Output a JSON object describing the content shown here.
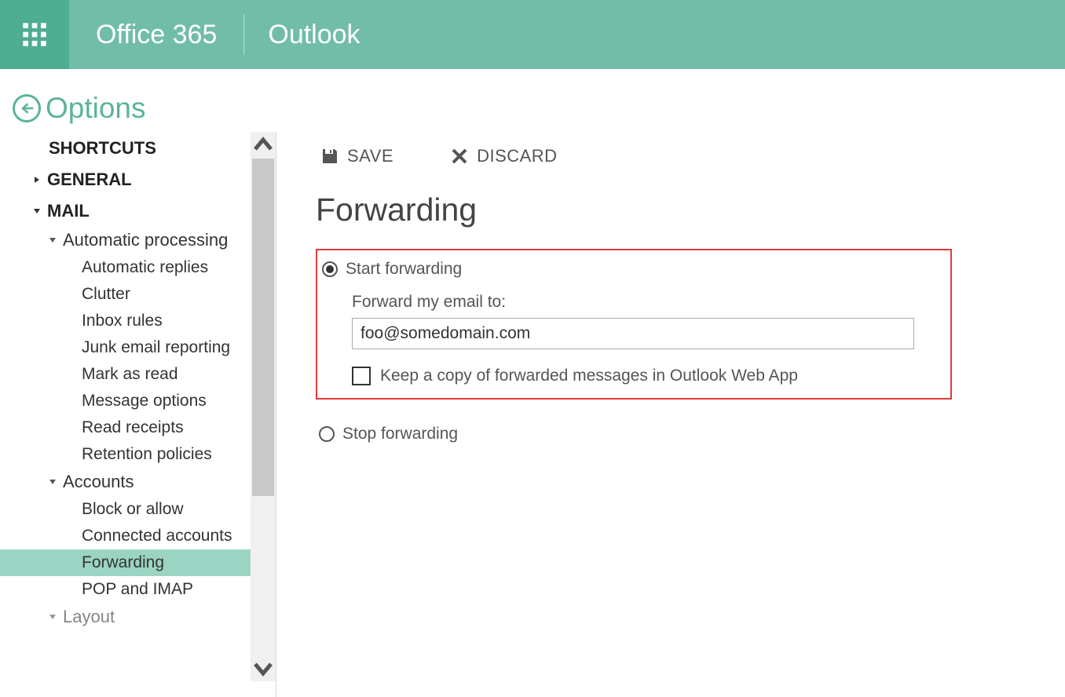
{
  "header": {
    "suite": "Office 365",
    "app": "Outlook"
  },
  "options_header": "Options",
  "sidebar": {
    "shortcuts": "SHORTCUTS",
    "general": "GENERAL",
    "mail": "MAIL",
    "auto_processing": "Automatic processing",
    "auto_items": [
      "Automatic replies",
      "Clutter",
      "Inbox rules",
      "Junk email reporting",
      "Mark as read",
      "Message options",
      "Read receipts",
      "Retention policies"
    ],
    "accounts": "Accounts",
    "account_items": [
      "Block or allow",
      "Connected accounts",
      "Forwarding",
      "POP and IMAP"
    ],
    "layout": "Layout"
  },
  "toolbar": {
    "save": "SAVE",
    "discard": "DISCARD"
  },
  "page": {
    "title": "Forwarding",
    "start_label": "Start forwarding",
    "forward_to_label": "Forward my email to:",
    "forward_to_value": "foo@somedomain.com",
    "keep_copy_label": "Keep a copy of forwarded messages in Outlook Web App",
    "stop_label": "Stop forwarding"
  }
}
